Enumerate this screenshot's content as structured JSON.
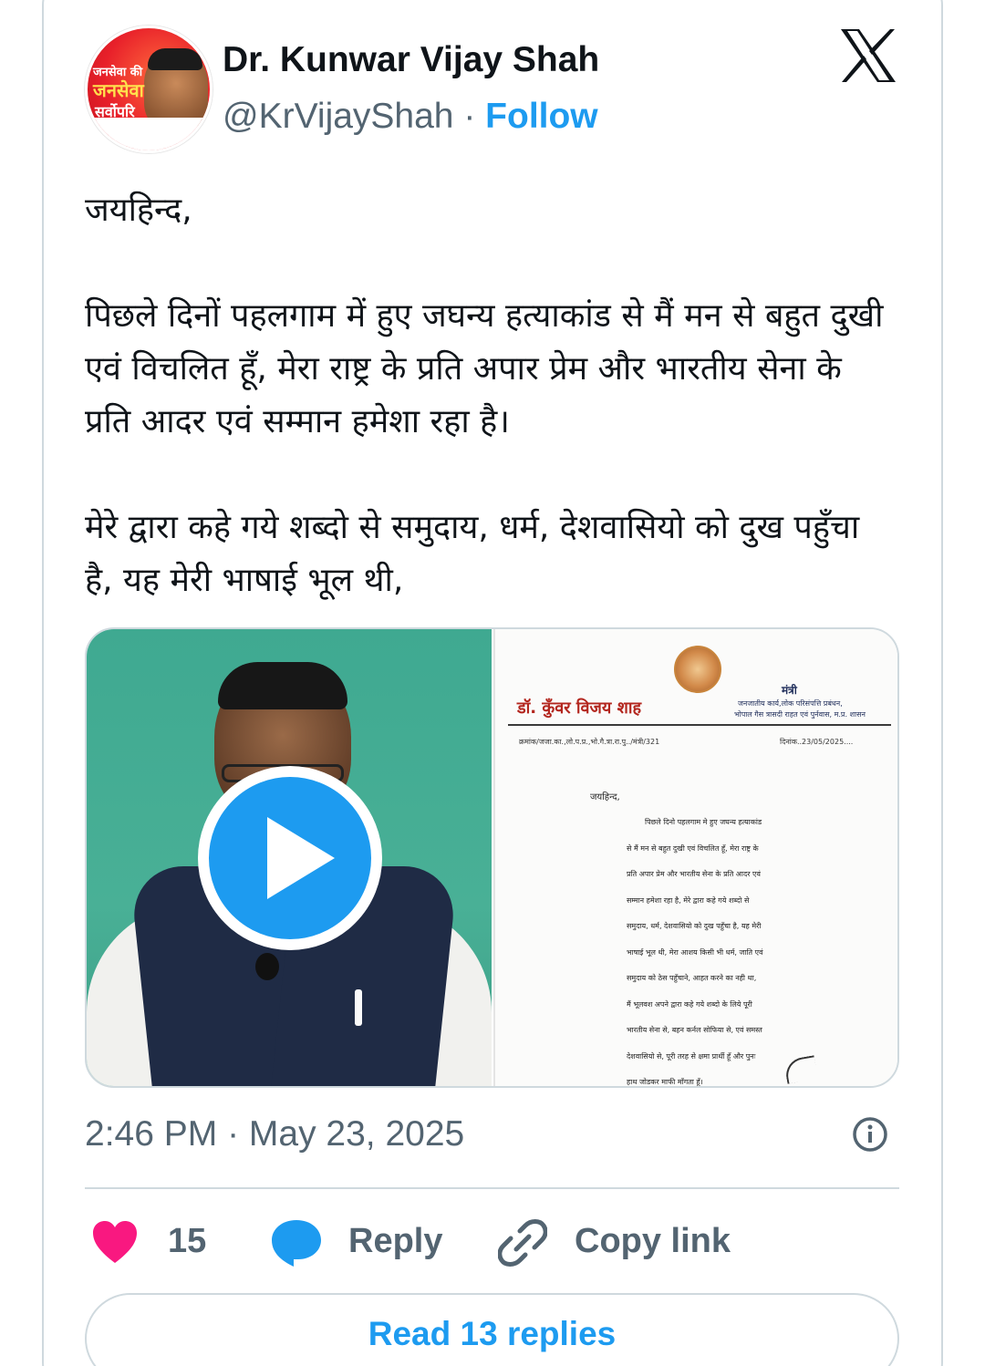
{
  "author": {
    "name": "Dr. Kunwar Vijay Shah",
    "handle": "@KrVijayShah",
    "separator": " · ",
    "follow_label": "Follow",
    "avatar_text": [
      "जनसेवा की",
      "जनसेवा",
      "सर्वोपरि"
    ]
  },
  "platform_icon": "x-logo-icon",
  "tweet": {
    "paragraphs": [
      "जयहिन्द,",
      "पिछले दिनों पहलगाम में हुए जघन्य हत्याकांड से मैं मन से बहुत दुखी एवं विचलित हूँ, मेरा राष्ट्र के प्रति अपार प्रेम और भारतीय सेना के प्रति आदर एवं सम्मान हमेशा रहा है।",
      "मेरे द्वारा कहे गये शब्दो से समुदाय, धर्म, देशवासियो को दुख पहुँचा है, यह मेरी भाषाई भूल थी,"
    ]
  },
  "media": {
    "video_play_icon": "play-icon",
    "document": {
      "name": "डॉ. कुँवर विजय शाह",
      "title": "मंत्री",
      "dept_line1": "जनजातीय कार्य,लोक परिसंपत्ति प्रबंधन,",
      "dept_line2": "भोपाल गैस त्रासदी राहत एवं पुर्नवास, म.प्र. शासन",
      "ref": "क्रमांक/जजा.का.,लो.प.प्र.,भो.गै.त्रा.रा.पु../मंत्री/321",
      "date": "दिनांक..23/05/2025....",
      "greeting": "जयहिन्द,",
      "body_lines": [
        "पिछले दिनो पहलगाम मे हुए जघन्य हत्याकांड",
        "से मैं मन से बहुत दुखी एवं विचलित हूँ, मेरा राष्ट्र के",
        "प्रति अपार प्रेम और भारतीय सेना के प्रति आदर एवं",
        "सम्मान हमेशा रहा है, मेरे द्वारा कहे गये शब्दो से",
        "समुदाय, धर्म, देशवासियो को दुख पहुँचा है, यह मेरी",
        "भाषाई भूल थी, मेरा आशय किसी भी धर्म, जाति एवं",
        "समुदाय को ठेस पहुँचाने, आहत करने का नही था,",
        "मैं भूलवश अपने द्वारा कहे गये शब्दो के लिये पूरी",
        "भारतीय सेना से, बहन कर्नल सोफिया से, एवं समस्त",
        "देशवासियो से, पूरी तरह से क्षमा प्रार्थी हूँ और पुनः",
        "हाथ जोडकर माफी माँगता हूँ।"
      ]
    }
  },
  "meta": {
    "timestamp": "2:46 PM · May 23, 2025",
    "info_icon": "info-icon"
  },
  "actions": {
    "like_count": "15",
    "reply_label": "Reply",
    "copy_link_label": "Copy link"
  },
  "read_replies_label": "Read 13 replies",
  "colors": {
    "accent": "#1d9bf0",
    "like": "#f91880",
    "muted": "#536471",
    "border": "#cfd9de"
  }
}
